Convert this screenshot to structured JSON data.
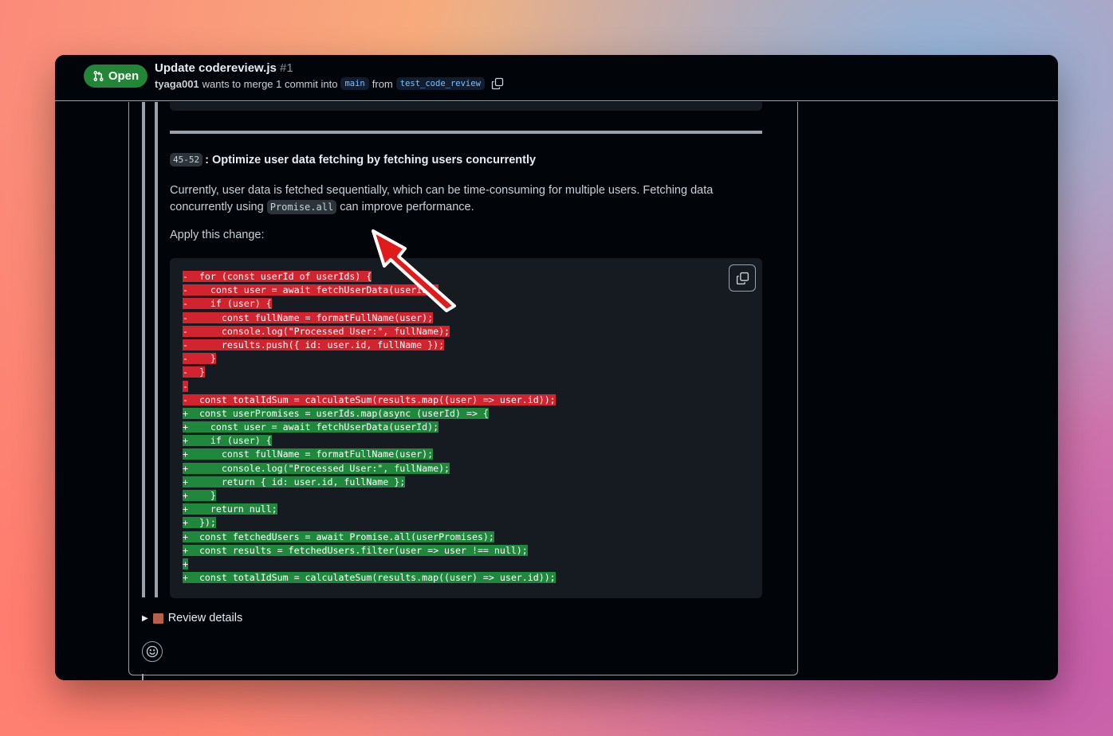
{
  "header": {
    "status_label": "Open",
    "title": "Update codereview.js",
    "number": "#1",
    "author": "tyaga001",
    "merge_text": "wants to merge 1 commit into",
    "base_branch": "main",
    "from_text": "from",
    "head_branch": "test_code_review"
  },
  "suggestion": {
    "line_range": "45-52",
    "title": ": Optimize user data fetching by fetching users concurrently",
    "desc_before": "Currently, user data is fetched sequentially, which can be time-consuming for multiple users. Fetching data concurrently using",
    "desc_code": "Promise.all",
    "desc_after": "can improve performance.",
    "apply_label": "Apply this change:"
  },
  "code": [
    {
      "type": "del",
      "text": "-  for (const userId of userIds) {"
    },
    {
      "type": "del",
      "text": "-    const user = await fetchUserData(userId);"
    },
    {
      "type": "del",
      "text": "-    if (user) {"
    },
    {
      "type": "del",
      "text": "-      const fullName = formatFullName(user);"
    },
    {
      "type": "del",
      "text": "-      console.log(\"Processed User:\", fullName);"
    },
    {
      "type": "del",
      "text": "-      results.push({ id: user.id, fullName });"
    },
    {
      "type": "del",
      "text": "-    }"
    },
    {
      "type": "del",
      "text": "-  }"
    },
    {
      "type": "del",
      "text": "-"
    },
    {
      "type": "del",
      "text": "-  const totalIdSum = calculateSum(results.map((user) => user.id));"
    },
    {
      "type": "add",
      "text": "+  const userPromises = userIds.map(async (userId) => {"
    },
    {
      "type": "add",
      "text": "+    const user = await fetchUserData(userId);"
    },
    {
      "type": "add",
      "text": "+    if (user) {"
    },
    {
      "type": "add",
      "text": "+      const fullName = formatFullName(user);"
    },
    {
      "type": "add",
      "text": "+      console.log(\"Processed User:\", fullName);"
    },
    {
      "type": "add",
      "text": "+      return { id: user.id, fullName };"
    },
    {
      "type": "add",
      "text": "+    }"
    },
    {
      "type": "add",
      "text": "+    return null;"
    },
    {
      "type": "add",
      "text": "+  });"
    },
    {
      "type": "add",
      "text": "+  const fetchedUsers = await Promise.all(userPromises);"
    },
    {
      "type": "add",
      "text": "+  const results = fetchedUsers.filter(user => user !== null);"
    },
    {
      "type": "add",
      "text": "+"
    },
    {
      "type": "add",
      "text": "+  const totalIdSum = calculateSum(results.map((user) => user.id));"
    }
  ],
  "review_details_label": "Review details",
  "colors": {
    "open_badge": "#238636",
    "deletion": "#d1242f",
    "addition": "#1f883d",
    "annotation_arrow": "#e01b1b"
  },
  "icons": {
    "status": "git-pull-request-icon",
    "copy_branch": "copy-icon",
    "copy_code": "copy-icon",
    "details_toggle": "triangle-right-icon",
    "details_emoji": "books-icon",
    "reaction": "smiley-icon"
  }
}
